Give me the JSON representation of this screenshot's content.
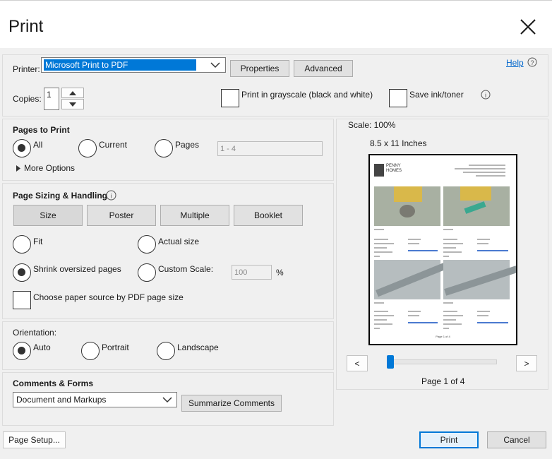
{
  "dialog": {
    "title": "Print"
  },
  "header": {
    "printer_label": "Printer:",
    "printer_value": "Microsoft Print to PDF",
    "properties_label": "Properties",
    "advanced_label": "Advanced",
    "help_label": "Help",
    "copies_label": "Copies:",
    "copies_value": "1",
    "grayscale_label": "Print in grayscale (black and white)",
    "save_ink_label": "Save ink/toner"
  },
  "pages_to_print": {
    "title": "Pages to Print",
    "all_label": "All",
    "current_label": "Current",
    "pages_label": "Pages",
    "pages_placeholder": "1 - 4",
    "more_options_label": "More Options",
    "selected": "All"
  },
  "sizing": {
    "title": "Page Sizing & Handling",
    "tabs": [
      "Size",
      "Poster",
      "Multiple",
      "Booklet"
    ],
    "fit_label": "Fit",
    "actual_size_label": "Actual size",
    "shrink_label": "Shrink oversized pages",
    "custom_scale_label": "Custom Scale:",
    "custom_scale_value": "100",
    "percent": "%",
    "paper_source_label": "Choose paper source by PDF page size",
    "selected": "Shrink oversized pages"
  },
  "orientation": {
    "title": "Orientation:",
    "auto_label": "Auto",
    "portrait_label": "Portrait",
    "landscape_label": "Landscape",
    "selected": "Auto"
  },
  "comments": {
    "title": "Comments & Forms",
    "value": "Document and Markups",
    "summarize_label": "Summarize Comments"
  },
  "preview": {
    "scale_text": "Scale: 100%",
    "paper_text": "8.5 x 11 Inches",
    "prev_label": "<",
    "next_label": ">",
    "page_indicator": "Page 1 of 4",
    "page_position": 0.0,
    "doc_brand": "PENNY HOMES",
    "doc_footer": "Page 1 of 4"
  },
  "footer": {
    "page_setup_label": "Page Setup...",
    "print_label": "Print",
    "cancel_label": "Cancel"
  },
  "colors": {
    "accent": "#0078d7",
    "link": "#0066cc"
  },
  "icons": [
    "close-icon",
    "dropdown-chevron-icon",
    "help-circle-icon",
    "info-icon",
    "expand-triangle-icon"
  ]
}
